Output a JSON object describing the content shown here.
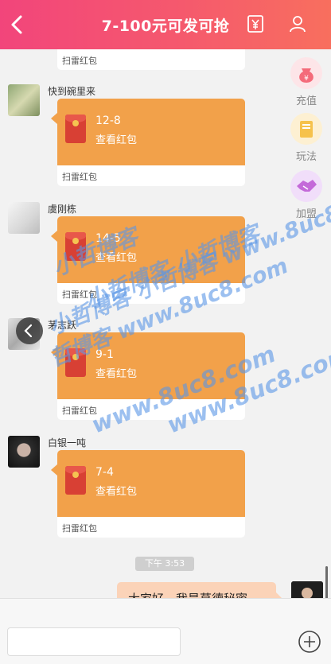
{
  "header": {
    "title": "7-100元可发可抢"
  },
  "chat": {
    "messages": [
      {
        "sender": "",
        "amount": "",
        "view_label": "",
        "type_label": "扫雷红包"
      },
      {
        "sender": "快到碗里来",
        "amount": "12-8",
        "view_label": "查看红包",
        "type_label": "扫雷红包"
      },
      {
        "sender": "虞刚栋",
        "amount": "14-5",
        "view_label": "查看红包",
        "type_label": "扫雷红包"
      },
      {
        "sender": "茅志跃",
        "amount": "9-1",
        "view_label": "查看红包",
        "type_label": "扫雷红包"
      },
      {
        "sender": "白银一吨",
        "amount": "7-4",
        "view_label": "查看红包",
        "type_label": "扫雷红包"
      }
    ],
    "time": "下午 3:53",
    "my_message": "大家好，我是草德秘密"
  },
  "side_menu": {
    "items": [
      {
        "label": "充值",
        "icon": "money-bag-icon",
        "color": "#f46b7a"
      },
      {
        "label": "玩法",
        "icon": "book-icon",
        "color": "#f6c24c"
      },
      {
        "label": "加盟",
        "icon": "handshake-icon",
        "color": "#c46ad9"
      }
    ]
  },
  "input": {
    "value": ""
  },
  "watermark": {
    "lines": [
      "小哲博客",
      "小哲博客 小哲博客",
      "小哲博客 小哲博客 www.8uc8.com",
      "哲博客 www.8uc8.com",
      "www.8uc8.com",
      "www.8uc8.com"
    ]
  },
  "colors": {
    "header_start": "#f2457b",
    "header_end": "#f86f5e",
    "red_packet": "#f2a14a",
    "my_bubble": "#fbd3b8"
  }
}
